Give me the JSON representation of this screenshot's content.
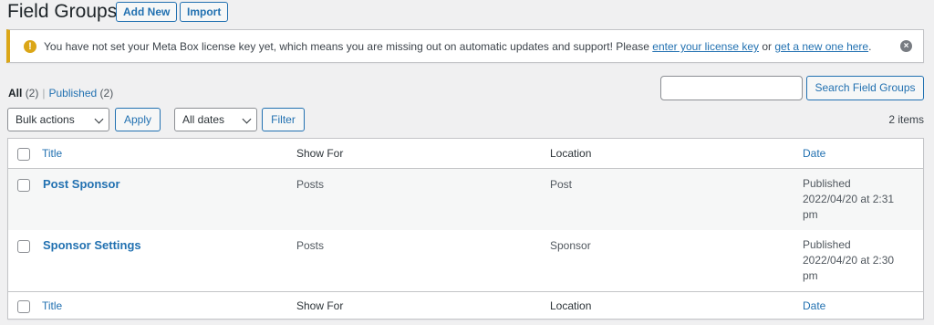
{
  "header": {
    "title": "Field Groups",
    "add_new_label": "Add New",
    "import_label": "Import"
  },
  "notice": {
    "icon": "warning-icon",
    "text_before": "You have not set your Meta Box license key yet, which means you are missing out on automatic updates and support! Please ",
    "link1": "enter your license key",
    "text_middle": " or ",
    "link2": "get a new one here",
    "text_after": ".",
    "dismiss_icon": "dismiss-icon"
  },
  "views": {
    "all_label": "All",
    "all_count": "(2)",
    "separator": "|",
    "published_label": "Published",
    "published_count": "(2)"
  },
  "search": {
    "placeholder": "",
    "button_label": "Search Field Groups"
  },
  "toolbar": {
    "bulk_actions": "Bulk actions",
    "apply_label": "Apply",
    "dates": "All dates",
    "filter_label": "Filter",
    "items_count": "2 items"
  },
  "table": {
    "columns": {
      "title": "Title",
      "show_for": "Show For",
      "location": "Location",
      "date": "Date"
    },
    "rows": [
      {
        "title": "Post Sponsor",
        "show_for": "Posts",
        "location": "Post",
        "date_status": "Published",
        "date_value": "2022/04/20 at 2:31 pm"
      },
      {
        "title": "Sponsor Settings",
        "show_for": "Posts",
        "location": "Sponsor",
        "date_status": "Published",
        "date_value": "2022/04/20 at 2:30 pm"
      }
    ]
  },
  "colors": {
    "accent": "#2271b1",
    "warning": "#dba617",
    "background": "#f0f0f1"
  }
}
